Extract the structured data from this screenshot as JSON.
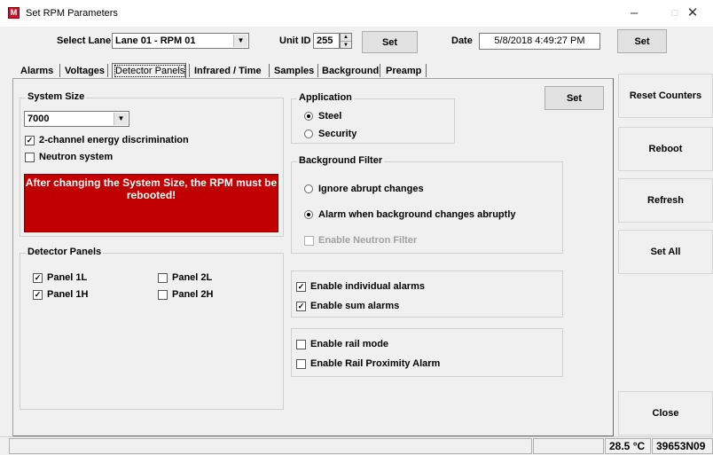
{
  "window": {
    "title": "Set RPM Parameters",
    "icon_letter": "M",
    "minimize": "–",
    "maximize": "□",
    "close": "✕"
  },
  "toolbar": {
    "select_lane_label": "Select Lane",
    "lane_value": "Lane 01 - RPM 01",
    "unit_id_label": "Unit ID",
    "unit_id_value": "255",
    "set_unit_label": "Set",
    "date_label": "Date",
    "date_value": "5/8/2018 4:49:27 PM",
    "set_date_label": "Set"
  },
  "tabs": [
    "Alarms",
    "Voltages",
    "Detector Panels",
    "Infrared / Time",
    "Samples",
    "Background",
    "Preamp"
  ],
  "system_size": {
    "legend": "System Size",
    "value": "7000",
    "energy_discrimination": "2-channel energy discrimination",
    "neutron_system": "Neutron system",
    "warning": "After changing the System Size, the RPM must be rebooted!"
  },
  "detector_panels": {
    "legend": "Detector Panels",
    "panels": [
      {
        "label": "Panel 1L",
        "checked": true
      },
      {
        "label": "Panel 2L",
        "checked": false
      },
      {
        "label": "Panel 1H",
        "checked": true
      },
      {
        "label": "Panel 2H",
        "checked": false
      }
    ]
  },
  "application": {
    "legend": "Application",
    "steel": "Steel",
    "security": "Security",
    "selected": "Steel"
  },
  "set_button": "Set",
  "background_filter": {
    "legend": "Background Filter",
    "ignore": "Ignore abrupt changes",
    "alarm": "Alarm when background changes abruptly",
    "neutron_filter": "Enable Neutron Filter"
  },
  "alarms": {
    "individual": "Enable individual alarms",
    "sum": "Enable sum alarms"
  },
  "rail": {
    "mode": "Enable rail mode",
    "proximity": "Enable Rail Proximity Alarm"
  },
  "side_buttons": {
    "reset_counters": "Reset Counters",
    "reboot": "Reboot",
    "refresh": "Refresh",
    "set_all": "Set All",
    "close": "Close"
  },
  "status": {
    "temperature": "28.5 °C",
    "serial": "39653N09"
  },
  "glyphs": {
    "check": "✓",
    "dropdown": "▼",
    "spin_up": "▲",
    "spin_down": "▼"
  },
  "colors": {
    "warning_bg": "#c00000",
    "app_icon": "#c8102e"
  }
}
